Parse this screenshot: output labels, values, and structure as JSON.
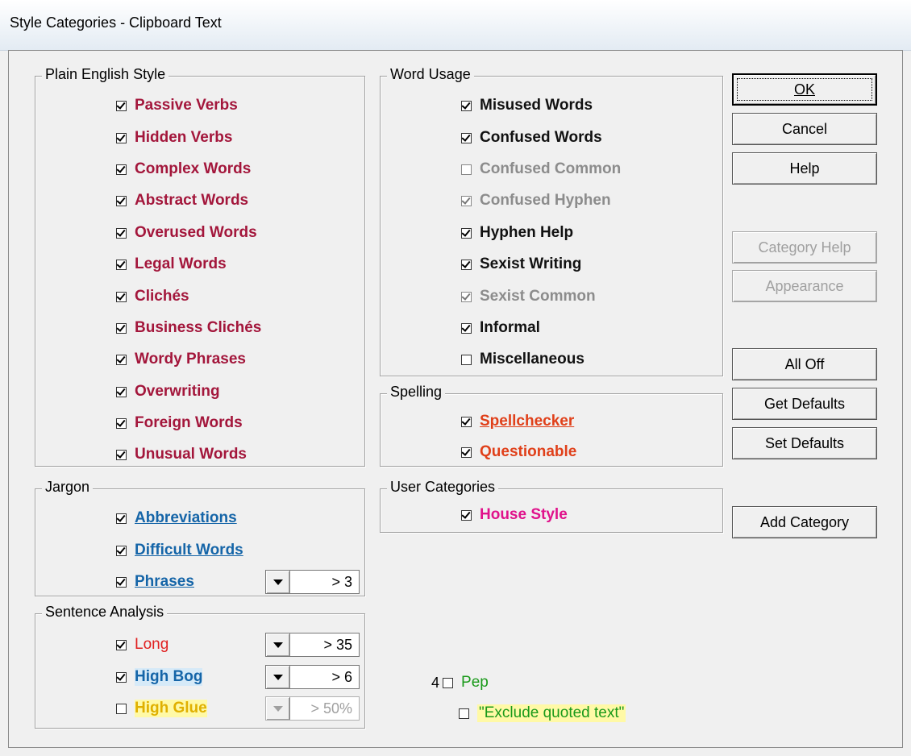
{
  "window": {
    "title": "Style Categories - Clipboard Text"
  },
  "plain_english": {
    "title": "Plain English Style",
    "items": [
      {
        "label": "Passive Verbs",
        "checked": true
      },
      {
        "label": "Hidden Verbs",
        "checked": true
      },
      {
        "label": "Complex Words",
        "checked": true
      },
      {
        "label": "Abstract Words",
        "checked": true
      },
      {
        "label": "Overused Words",
        "checked": true
      },
      {
        "label": "Legal Words",
        "checked": true
      },
      {
        "label": "Clichés",
        "checked": true
      },
      {
        "label": "Business Clichés",
        "checked": true
      },
      {
        "label": "Wordy Phrases",
        "checked": true
      },
      {
        "label": "Overwriting",
        "checked": true
      },
      {
        "label": "Foreign Words",
        "checked": true
      },
      {
        "label": "Unusual Words",
        "checked": true
      }
    ]
  },
  "word_usage": {
    "title": "Word Usage",
    "items": [
      {
        "label": "Misused Words",
        "checked": true,
        "enabled": true
      },
      {
        "label": "Confused Words",
        "checked": true,
        "enabled": true
      },
      {
        "label": "Confused Common",
        "checked": false,
        "enabled": false
      },
      {
        "label": "Confused Hyphen",
        "checked": true,
        "enabled": false
      },
      {
        "label": "Hyphen Help",
        "checked": true,
        "enabled": true
      },
      {
        "label": "Sexist Writing",
        "checked": true,
        "enabled": true
      },
      {
        "label": "Sexist Common",
        "checked": true,
        "enabled": false
      },
      {
        "label": "Informal",
        "checked": true,
        "enabled": true
      },
      {
        "label": "Miscellaneous",
        "checked": false,
        "enabled": true
      }
    ]
  },
  "spelling": {
    "title": "Spelling",
    "items": [
      {
        "label": "Spellchecker",
        "checked": true
      },
      {
        "label": "Questionable",
        "checked": true
      }
    ]
  },
  "user_categories": {
    "title": "User Categories",
    "items": [
      {
        "label": "House Style",
        "checked": true
      }
    ]
  },
  "jargon": {
    "title": "Jargon",
    "items": [
      {
        "label": "Abbreviations",
        "checked": true
      },
      {
        "label": "Difficult Words",
        "checked": true
      },
      {
        "label": "Phrases",
        "checked": true,
        "combo": "> 3"
      }
    ]
  },
  "sentence_analysis": {
    "title": "Sentence Analysis",
    "items": [
      {
        "label": "Long",
        "checked": true,
        "combo": "> 35"
      },
      {
        "label": "High Bog",
        "checked": true,
        "combo": "> 6"
      },
      {
        "label": "High Glue",
        "checked": false,
        "combo": "> 50%"
      }
    ]
  },
  "pep": {
    "prefix": "4",
    "label": "Pep",
    "checked": false
  },
  "exclude_quoted": {
    "label": "\"Exclude quoted text\"",
    "checked": false
  },
  "buttons": {
    "ok": "OK",
    "cancel": "Cancel",
    "help": "Help",
    "category_help": "Category Help",
    "appearance": "Appearance",
    "all_off": "All Off",
    "get_defaults": "Get Defaults",
    "set_defaults": "Set Defaults",
    "add_category": "Add Category"
  },
  "colors": {
    "plain_english": "#a3163b",
    "spelling": "#e0401a",
    "user_category": "#e0128b",
    "jargon": "#1565a8",
    "long": "#e02020",
    "high_glue": "#e0b000",
    "pep": "#1a9a1a"
  },
  "icons": {
    "checkbox": "checkmark",
    "combo_arrow": "triangle-down"
  }
}
